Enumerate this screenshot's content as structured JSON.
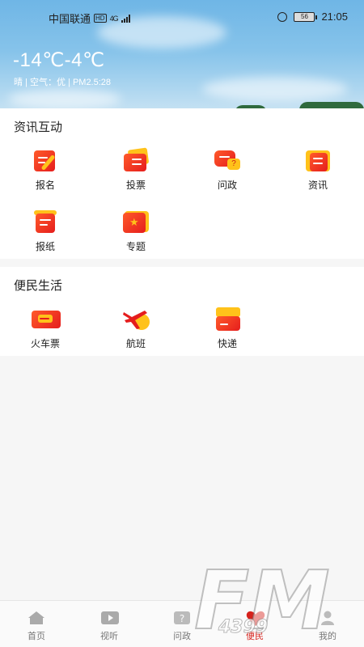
{
  "status_bar": {
    "carrier": "中国联通",
    "hd": "HD",
    "network": "4G",
    "battery": "56",
    "time": "21:05"
  },
  "weather": {
    "temperature": "-14℃-4℃",
    "info": "晴 | 空气：优 | PM2.5:28"
  },
  "section_news": {
    "title": "资讯互动",
    "items": [
      {
        "label": "报名",
        "icon": "signup-pencil-icon"
      },
      {
        "label": "投票",
        "icon": "vote-ticket-icon"
      },
      {
        "label": "问政",
        "icon": "question-chat-icon"
      },
      {
        "label": "资讯",
        "icon": "news-doc-icon"
      },
      {
        "label": "报纸",
        "icon": "newspaper-icon"
      },
      {
        "label": "专题",
        "icon": "topic-star-icon"
      }
    ]
  },
  "section_life": {
    "title": "便民生活",
    "items": [
      {
        "label": "火车票",
        "icon": "train-ticket-icon"
      },
      {
        "label": "航班",
        "icon": "airplane-icon"
      },
      {
        "label": "快递",
        "icon": "parcel-icon"
      }
    ]
  },
  "tab_bar": {
    "items": [
      {
        "label": "首页",
        "icon": "home-icon"
      },
      {
        "label": "视听",
        "icon": "video-play-icon"
      },
      {
        "label": "问政",
        "icon": "question-icon"
      },
      {
        "label": "便民",
        "icon": "heart-icon"
      },
      {
        "label": "我的",
        "icon": "person-icon"
      }
    ],
    "active_index": 3
  },
  "watermark": {
    "text_large": "FM",
    "text_small": "4399"
  },
  "colors": {
    "accent_red": "#e51d1d",
    "accent_yellow": "#ffc21a",
    "sky_blue": "#86c3ea"
  }
}
